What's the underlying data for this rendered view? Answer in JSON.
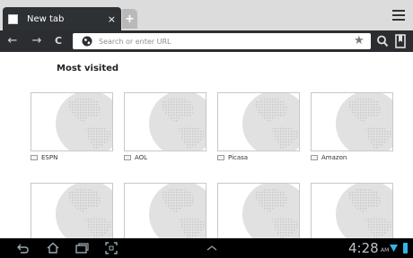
{
  "tab": {
    "title": "New tab",
    "close_glyph": "×",
    "new_tab_glyph": "+"
  },
  "toolbar": {
    "back_glyph": "←",
    "forward_glyph": "→",
    "reload_glyph": "C",
    "omnibox_placeholder": "Search or enter URL",
    "star_glyph": "★"
  },
  "section": {
    "title": "Most visited"
  },
  "thumbnails": [
    {
      "label": "ESPN"
    },
    {
      "label": "AOL"
    },
    {
      "label": "Picasa"
    },
    {
      "label": "Amazon"
    },
    {
      "label": ""
    },
    {
      "label": ""
    },
    {
      "label": ""
    },
    {
      "label": ""
    }
  ],
  "status": {
    "time": "4:28",
    "ampm": "AM"
  },
  "colors": {
    "accent": "#33b5e5",
    "toolbar": "#2b2d30",
    "tabstrip": "#dcdcdc"
  },
  "icons": [
    "menu-icon",
    "globe-icon",
    "star-icon",
    "search-icon",
    "bookmarks-icon",
    "back-icon",
    "home-icon",
    "recent-apps-icon",
    "screenshot-icon",
    "up-icon",
    "wifi-icon",
    "battery-icon"
  ]
}
